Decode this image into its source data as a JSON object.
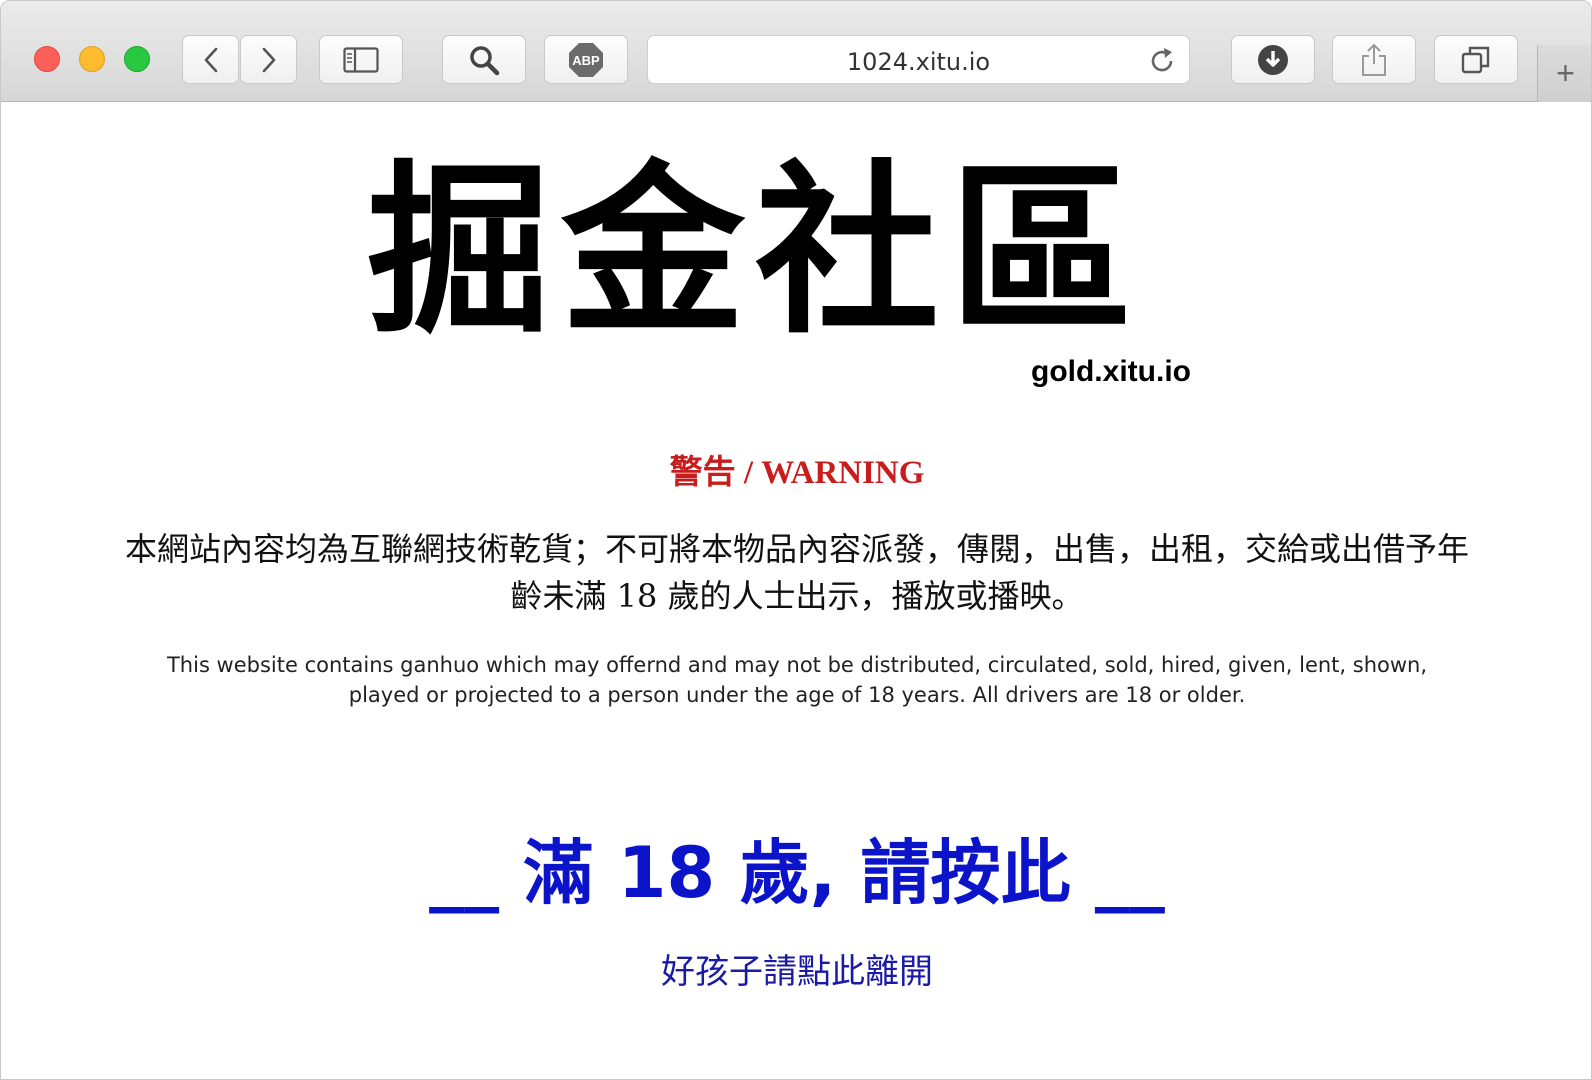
{
  "browser": {
    "url": "1024.xitu.io",
    "icons": {
      "back": "chevron-left-icon",
      "forward": "chevron-right-icon",
      "sidebar": "sidebar-icon",
      "search": "search-icon",
      "adblock": "abp-icon",
      "reload": "reload-icon",
      "downloads": "download-icon",
      "share": "share-icon",
      "tabs": "tabs-icon",
      "new_tab": "plus-icon"
    },
    "abp_label": "ABP",
    "new_tab_label": "+"
  },
  "page": {
    "logo_text": "掘金社區",
    "logo_domain": "gold.xitu.io",
    "warning_title": "警告 / WARNING",
    "zh_notice": "本網站內容均為互聯網技術乾貨；不可將本物品內容派發，傳閱，出售，出租，交給或出借予年齡未滿 18 歲的人士出示，播放或播映。",
    "en_notice": "This website contains ganhuo which may offernd and may not be distributed, circulated, sold, hired, given, lent, shown, played or projected to a person under the age of 18 years. All drivers are 18 or older.",
    "enter_label": "__ 滿 18 歲, 請按此 __",
    "leave_label": "好孩子請點此離開"
  },
  "colors": {
    "warning": "#c91d1d",
    "enter_link": "#0b14c8",
    "leave_link": "#1a1aa6"
  }
}
